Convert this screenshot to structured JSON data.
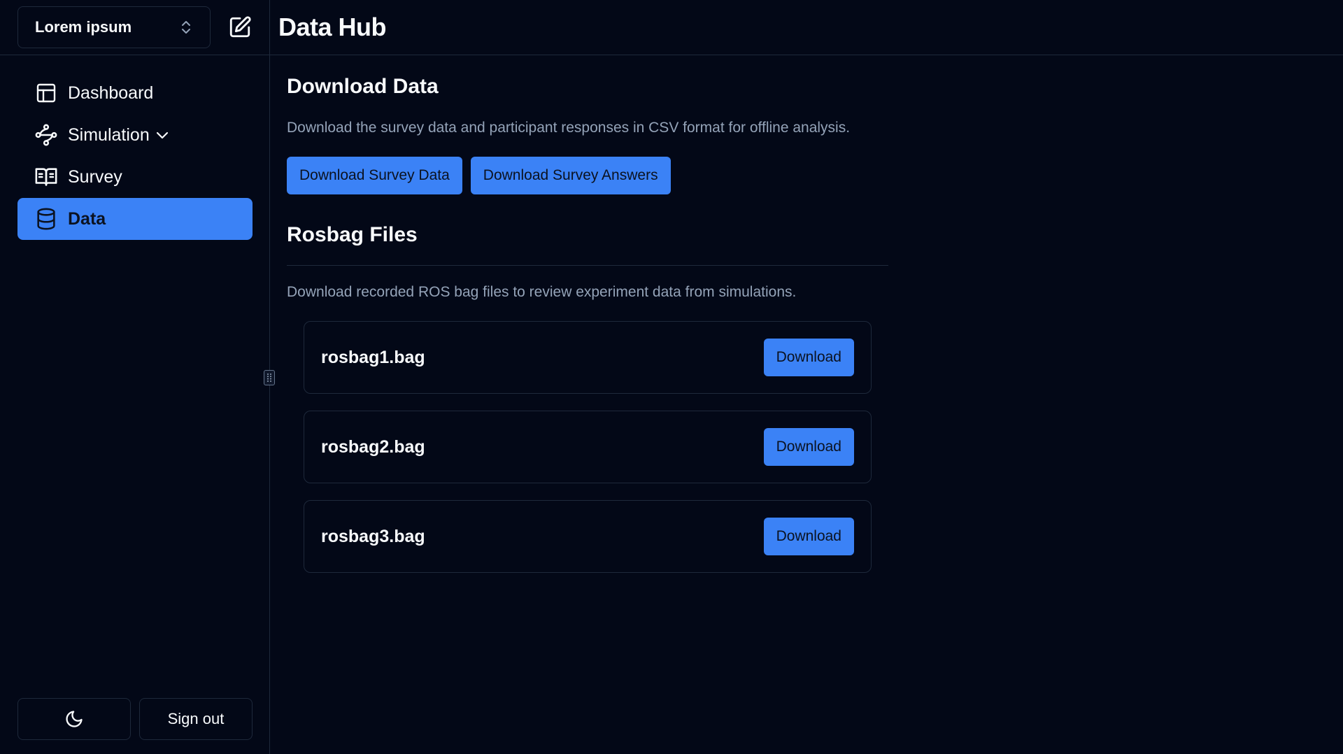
{
  "workspace": {
    "selected": "Lorem ipsum"
  },
  "page_title": "Data Hub",
  "sidebar": {
    "items": [
      {
        "label": "Dashboard",
        "icon": "layout-icon"
      },
      {
        "label": "Simulation",
        "icon": "workflow-icon"
      },
      {
        "label": "Survey",
        "icon": "book-open-icon"
      },
      {
        "label": "Data",
        "icon": "database-icon",
        "active": true
      }
    ],
    "footer": {
      "theme_icon": "moon-icon",
      "sign_out_label": "Sign out"
    }
  },
  "download_section": {
    "title": "Download Data",
    "description": "Download the survey data and participant responses in CSV format for offline analysis.",
    "buttons": [
      "Download Survey Data",
      "Download Survey Answers"
    ]
  },
  "rosbag_section": {
    "title": "Rosbag Files",
    "description": "Download recorded ROS bag files to review experiment data from simulations.",
    "files": [
      {
        "name": "rosbag1.bag",
        "action": "Download"
      },
      {
        "name": "rosbag2.bag",
        "action": "Download"
      },
      {
        "name": "rosbag3.bag",
        "action": "Download"
      }
    ]
  },
  "colors": {
    "background": "#030817",
    "accent": "#3b82f6",
    "border": "#1e293b",
    "muted_text": "#94a3b8"
  }
}
